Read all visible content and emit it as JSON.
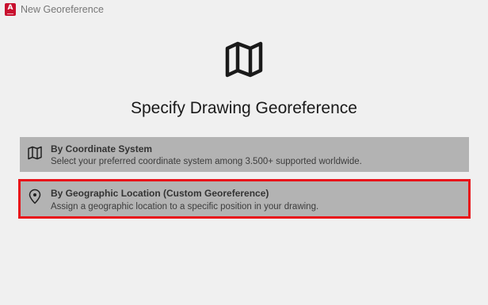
{
  "window": {
    "title": "New Georeference",
    "app_icon_letter": "A",
    "app_icon_color": "#c8102e"
  },
  "main": {
    "hero_icon": "map-icon",
    "heading": "Specify Drawing Georeference",
    "options": [
      {
        "icon": "map-icon",
        "title": "By Coordinate System",
        "description": "Select your preferred coordinate system among 3.500+ supported worldwide.",
        "highlighted": false
      },
      {
        "icon": "location-pin-icon",
        "title": "By Geographic Location (Custom Georeference)",
        "description": "Assign a geographic location to a specific position in your drawing.",
        "highlighted": true
      }
    ]
  },
  "colors": {
    "background": "#f0f0f0",
    "option_background": "#b3b3b3",
    "highlight_border": "#e8141a"
  }
}
